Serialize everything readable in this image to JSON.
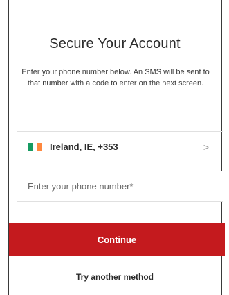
{
  "title": "Secure Your Account",
  "description": "Enter your phone number below. An SMS will be sent to that number with a code to enter on the next screen.",
  "country_selector": {
    "label": "Ireland, IE, +353",
    "chevron": ">",
    "flag_icon": "ireland-flag-icon",
    "flag_colors": [
      "#169b62",
      "#ffffff",
      "#ff883e"
    ]
  },
  "phone_input": {
    "placeholder": "Enter your phone number*",
    "value": ""
  },
  "continue_label": "Continue",
  "try_another_label": "Try another method",
  "colors": {
    "accent": "#c41a1e",
    "text": "#2b2b2b",
    "border": "#e0e0e0"
  }
}
